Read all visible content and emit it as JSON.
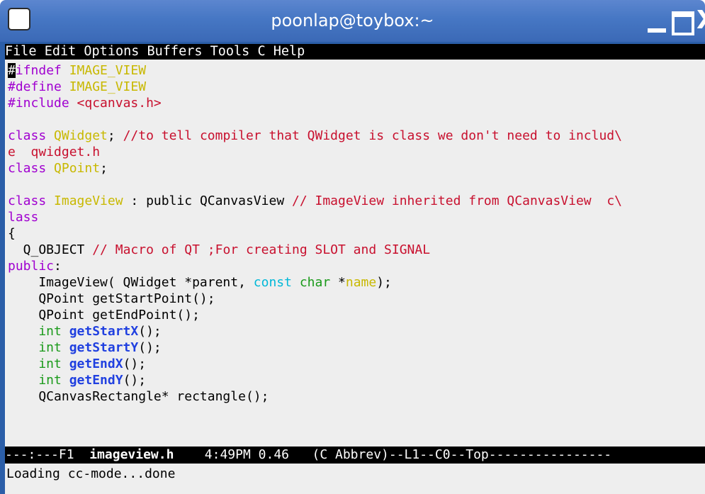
{
  "window": {
    "title": "poonlap@toybox:~",
    "close_glyph": "X"
  },
  "menu": [
    "File",
    "Edit",
    "Options",
    "Buffers",
    "Tools",
    "C",
    "Help"
  ],
  "code": {
    "l1_a": "#",
    "l1_b": "ifndef ",
    "l1_c": "IMAGE_VIEW",
    "l2_a": "#define ",
    "l2_b": "IMAGE_VIEW",
    "l3_a": "#include ",
    "l3_b": "<qcanvas.h>",
    "l5_a": "class ",
    "l5_b": "QWidget",
    "l5_c": "; ",
    "l5_d": "//to tell compiler that QWidget is class we don't need to includ\\",
    "l6_a": "e  qwidget.h",
    "l7_a": "class ",
    "l7_b": "QPoint",
    "l7_c": ";",
    "l9_a": "class ",
    "l9_b": "ImageView",
    "l9_c": " : public QCanvasView ",
    "l9_d": "// ImageView inherited from QCanvasView  c\\",
    "l10_a": "lass",
    "l11_a": "{",
    "l12_a": "  Q_OBJECT ",
    "l12_b": "// Macro of QT ;For creating SLOT and SIGNAL",
    "l13_a": "public",
    "l13_b": ":",
    "l14_a": "    ImageView( QWidget *parent, ",
    "l14_b": "const",
    "l14_c": " ",
    "l14_d": "char",
    "l14_e": " *",
    "l14_f": "name",
    "l14_g": ");",
    "l15_a": "    QPoint getStartPoint();",
    "l16_a": "    QPoint getEndPoint();",
    "l17_a": "    int ",
    "l17_b": "getStartX",
    "l17_c": "();",
    "l18_a": "    int ",
    "l18_b": "getStartY",
    "l18_c": "();",
    "l19_a": "    int ",
    "l19_b": "getEndX",
    "l19_c": "();",
    "l20_a": "    int ",
    "l20_b": "getEndY",
    "l20_c": "();",
    "l21_a": "    QCanvasRectangle* rectangle();"
  },
  "modeline": {
    "prefix": "---:---F1  ",
    "buffer_name": "imageview.h",
    "rest": "    4:49PM 0.46   (C Abbrev)--L1--C0--Top----------------"
  },
  "echo_area": "Loading cc-mode...done",
  "colors": {
    "titlebar": "#4677c4",
    "preprocessor": "#a000d0",
    "type_name": "#c8b800",
    "comment": "#c8102e",
    "keyword_type": "#1a9a1a",
    "function_name": "#2040e0",
    "const_keyword": "#00b8d8"
  }
}
